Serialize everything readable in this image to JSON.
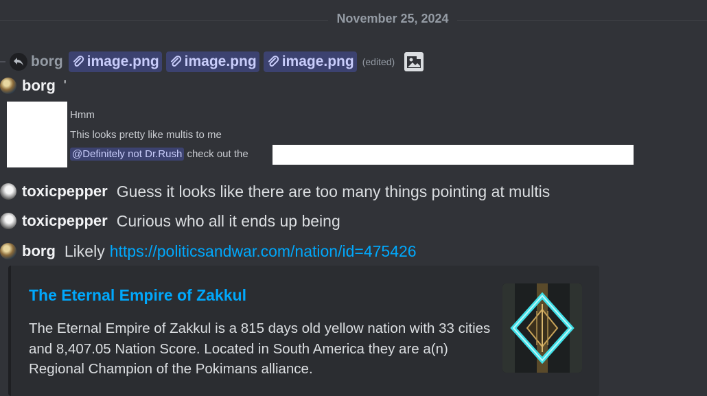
{
  "date_divider": "November 25, 2024",
  "reply": {
    "username": "borg",
    "attachments": [
      "image.png",
      "image.png",
      "image.png"
    ],
    "edited_label": "(edited)",
    "icons": {
      "reply": "reply-arrow-icon",
      "attachment": "paperclip-icon",
      "image": "image-icon"
    }
  },
  "messages": [
    {
      "username": "borg",
      "text": "'",
      "screenshot_lines": [
        "Hmm",
        "This looks pretty like multis to me"
      ],
      "screenshot_mention": "@Definitely not Dr.Rush",
      "screenshot_after_mention": "check out the"
    },
    {
      "username": "toxicpepper",
      "text": "Guess it looks like there are too many things pointing at multis"
    },
    {
      "username": "toxicpepper",
      "text": "Curious who all it ends up being"
    },
    {
      "username": "borg",
      "text": "Likely",
      "link": "https://politicsandwar.com/nation/id=475426"
    }
  ],
  "embed": {
    "title": "The Eternal Empire of Zakkul",
    "description": "The Eternal Empire of Zakkul is a 815 days old yellow nation with 33 cities and 8,407.05 Nation Score. Located in South America they are a(n) Regional Champion of the Pokimans alliance.",
    "thumbnail_icon": "nation-flag-icon",
    "colors": {
      "link": "#00a8fc",
      "glow": "#3fe0e8"
    }
  },
  "colors": {
    "background": "#313338",
    "mention_bg": "#3c4270",
    "mention_text": "#c9cdfb"
  }
}
